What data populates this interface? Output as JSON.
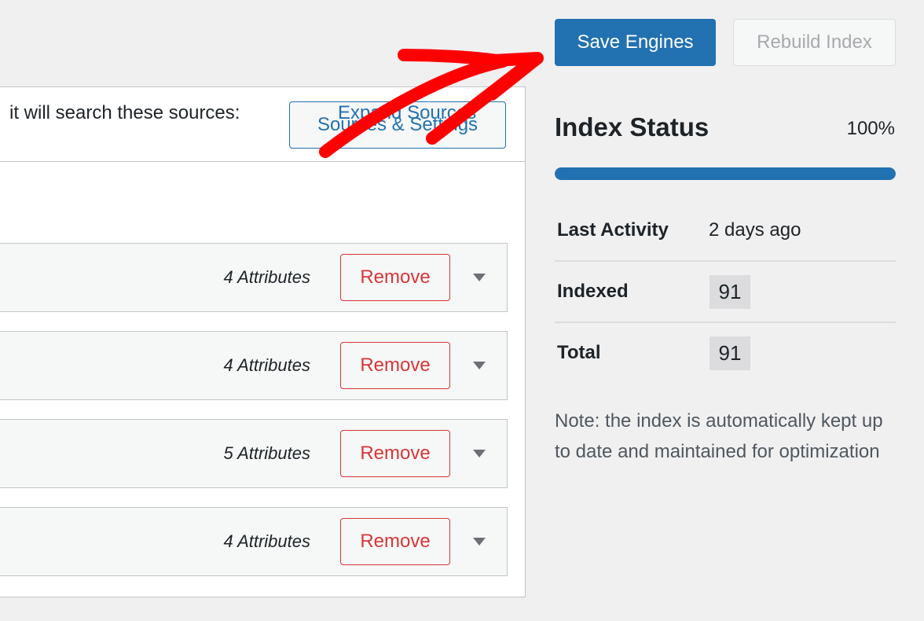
{
  "toolbar": {
    "save_label": "Save Engines",
    "rebuild_label": "Rebuild Index"
  },
  "engine": {
    "sources_settings_label": "Sources & Settings",
    "intro_text": "it will search these sources:",
    "expand_label": "Expand Sources",
    "sources": [
      {
        "attributes": "4 Attributes",
        "remove_label": "Remove"
      },
      {
        "attributes": "4 Attributes",
        "remove_label": "Remove"
      },
      {
        "attributes": "5 Attributes",
        "remove_label": "Remove"
      },
      {
        "attributes": "4 Attributes",
        "remove_label": "Remove"
      }
    ]
  },
  "index_status": {
    "title": "Index Status",
    "percent": "100%",
    "progress_fraction": 1.0,
    "stats": [
      {
        "label": "Last Activity",
        "value": "2 days ago"
      },
      {
        "label": "Indexed",
        "value": "91"
      },
      {
        "label": "Total",
        "value": "91"
      }
    ],
    "note": "Note: the index is automatically kept up to date and maintained for optimization"
  },
  "annotation": {
    "icon": "red-arrow-icon",
    "color": "#ff0000"
  },
  "colors": {
    "accent": "#2271b1",
    "danger": "#d63638"
  }
}
